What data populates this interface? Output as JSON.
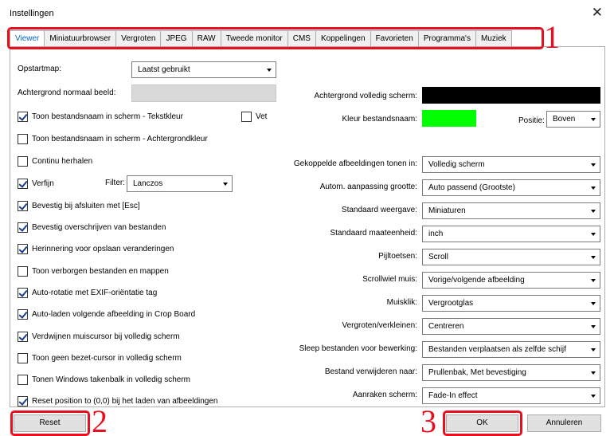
{
  "window": {
    "title": "Instellingen",
    "close_glyph": "✕"
  },
  "tabs": [
    "Viewer",
    "Miniatuurbrowser",
    "Vergroten",
    "JPEG",
    "RAW",
    "Tweede monitor",
    "CMS",
    "Koppelingen",
    "Favorieten",
    "Programma's",
    "Muziek"
  ],
  "left": {
    "startup_label": "Opstartmap:",
    "startup_value": "Laatst gebruikt",
    "bg_normal_label": "Achtergrond normaal beeld:",
    "bg_normal_color": "#d9d9d9",
    "checkboxes": [
      {
        "label": "Toon bestandsnaam in scherm - Tekstkleur",
        "checked": true
      },
      {
        "label": "Toon bestandsnaam in scherm - Achtergrondkleur",
        "checked": false
      },
      {
        "label": "Continu herhalen",
        "checked": false
      },
      {
        "label": "Verfijn",
        "checked": true
      },
      {
        "label": "Bevestig bij afsluiten met [Esc]",
        "checked": true
      },
      {
        "label": "Bevestig overschrijven van bestanden",
        "checked": true
      },
      {
        "label": "Herinnering voor opslaan veranderingen",
        "checked": true
      },
      {
        "label": "Toon verborgen bestanden en mappen",
        "checked": false
      },
      {
        "label": "Auto-rotatie met EXIF-oriëntatie tag",
        "checked": true
      },
      {
        "label": "Auto-laden volgende afbeelding in Crop Board",
        "checked": true
      },
      {
        "label": "Verdwijnen muiscursor bij volledig scherm",
        "checked": true
      },
      {
        "label": "Toon geen bezet-cursor in volledig scherm",
        "checked": false
      },
      {
        "label": "Tonen Windows takenbalk in volledig scherm",
        "checked": false
      },
      {
        "label": "Reset position to (0,0) bij het laden van afbeeldingen",
        "checked": true
      }
    ],
    "bold": {
      "label": "Vet",
      "checked": false
    },
    "filter_label": "Filter:",
    "filter_value": "Lanczos"
  },
  "right": {
    "bg_full_label": "Achtergrond volledig scherm:",
    "bg_full_color": "#000000",
    "filename_color_label": "Kleur bestandsnaam:",
    "filename_color": "#00ff00",
    "position_label": "Positie:",
    "position_value": "Boven",
    "rows": [
      {
        "label": "Gekoppelde afbeeldingen tonen in:",
        "value": "Volledig scherm"
      },
      {
        "label": "Autom. aanpassing grootte:",
        "value": "Auto passend (Grootste)"
      },
      {
        "label": "Standaard weergave:",
        "value": "Miniaturen"
      },
      {
        "label": "Standaard maateenheid:",
        "value": "inch"
      },
      {
        "label": "Pijltoetsen:",
        "value": "Scroll"
      },
      {
        "label": "Scrollwiel muis:",
        "value": "Vorige/volgende afbeelding"
      },
      {
        "label": "Muisklik:",
        "value": "Vergrootglas"
      },
      {
        "label": "Vergroten/verkleinen:",
        "value": "Centreren"
      },
      {
        "label": "Sleep bestanden voor bewerking:",
        "value": "Bestanden verplaatsen als zelfde schijf"
      },
      {
        "label": "Bestand verwijderen naar:",
        "value": "Prullenbak, Met bevestiging"
      },
      {
        "label": "Aanraken scherm:",
        "value": "Fade-In effect"
      }
    ]
  },
  "buttons": {
    "reset": "Reset",
    "ok": "OK",
    "cancel": "Annuleren"
  },
  "annotations": {
    "n1": "1",
    "n2": "2",
    "n3": "3",
    "color": "#e8101e"
  }
}
